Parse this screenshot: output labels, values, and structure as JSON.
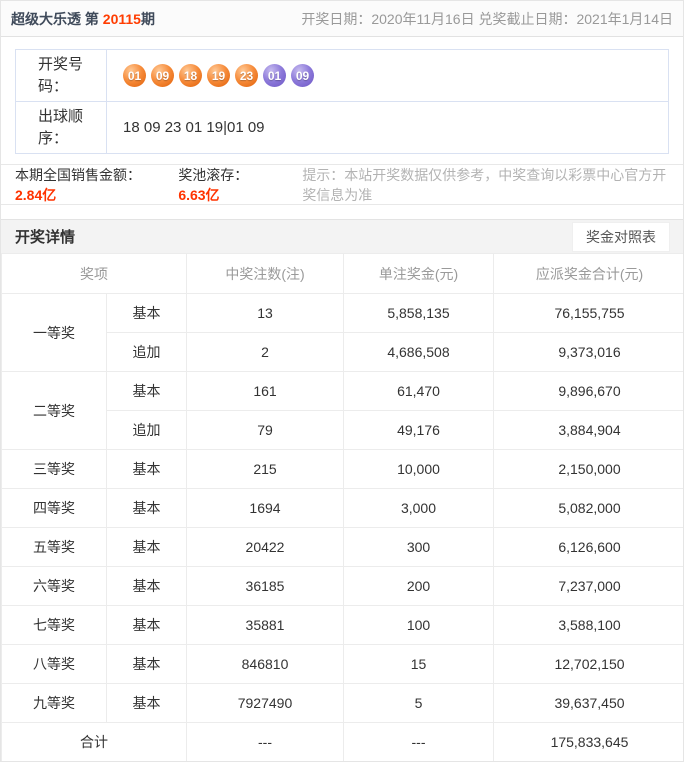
{
  "topbar": {
    "title_prefix": "超级大乐透 第 ",
    "issue": "20115",
    "title_suffix": "期",
    "dates": "开奖日期：2020年11月16日 兑奖截止日期：2021年1月14日"
  },
  "numbers": {
    "draw_label": "开奖号码：",
    "front_balls": [
      "01",
      "09",
      "18",
      "19",
      "23"
    ],
    "back_balls": [
      "01",
      "09"
    ],
    "order_label": "出球顺序：",
    "order_value": "18 09 23 01 19|01 09"
  },
  "sales": {
    "sales_label": "本期全国销售金额：",
    "sales_value": "2.84亿",
    "pool_label": "奖池滚存：",
    "pool_value": "6.63亿",
    "hint": "提示：本站开奖数据仅供参考，中奖查询以彩票中心官方开奖信息为准"
  },
  "details": {
    "title": "开奖详情",
    "compare_button": "奖金对照表"
  },
  "prize_table": {
    "columns": [
      "奖项",
      "中奖注数(注)",
      "单注奖金(元)",
      "应派奖金合计(元)"
    ],
    "rows": [
      {
        "prize": "一等奖",
        "prize_rowspan": 2,
        "type": "基本",
        "count": "13",
        "single": "5,858,135",
        "total": "76,155,755"
      },
      {
        "type": "追加",
        "count": "2",
        "single": "4,686,508",
        "total": "9,373,016"
      },
      {
        "prize": "二等奖",
        "prize_rowspan": 2,
        "type": "基本",
        "count": "161",
        "single": "61,470",
        "total": "9,896,670"
      },
      {
        "type": "追加",
        "count": "79",
        "single": "49,176",
        "total": "3,884,904"
      },
      {
        "prize": "三等奖",
        "prize_rowspan": 1,
        "type": "基本",
        "count": "215",
        "single": "10,000",
        "total": "2,150,000"
      },
      {
        "prize": "四等奖",
        "prize_rowspan": 1,
        "type": "基本",
        "count": "1694",
        "single": "3,000",
        "total": "5,082,000"
      },
      {
        "prize": "五等奖",
        "prize_rowspan": 1,
        "type": "基本",
        "count": "20422",
        "single": "300",
        "total": "6,126,600"
      },
      {
        "prize": "六等奖",
        "prize_rowspan": 1,
        "type": "基本",
        "count": "36185",
        "single": "200",
        "total": "7,237,000"
      },
      {
        "prize": "七等奖",
        "prize_rowspan": 1,
        "type": "基本",
        "count": "35881",
        "single": "100",
        "total": "3,588,100"
      },
      {
        "prize": "八等奖",
        "prize_rowspan": 1,
        "type": "基本",
        "count": "846810",
        "single": "15",
        "total": "12,702,150"
      },
      {
        "prize": "九等奖",
        "prize_rowspan": 1,
        "type": "基本",
        "count": "7927490",
        "single": "5",
        "total": "39,637,450"
      }
    ],
    "footer": {
      "label": "合计",
      "count": "---",
      "single": "---",
      "total": "175,833,645"
    }
  },
  "colors": {
    "accent_red": "#ff3300",
    "ball_orange": "#f08030",
    "ball_purple": "#7a66cc",
    "title_dark": "#3f4a5a",
    "border_light_blue": "#d9e1f2"
  }
}
